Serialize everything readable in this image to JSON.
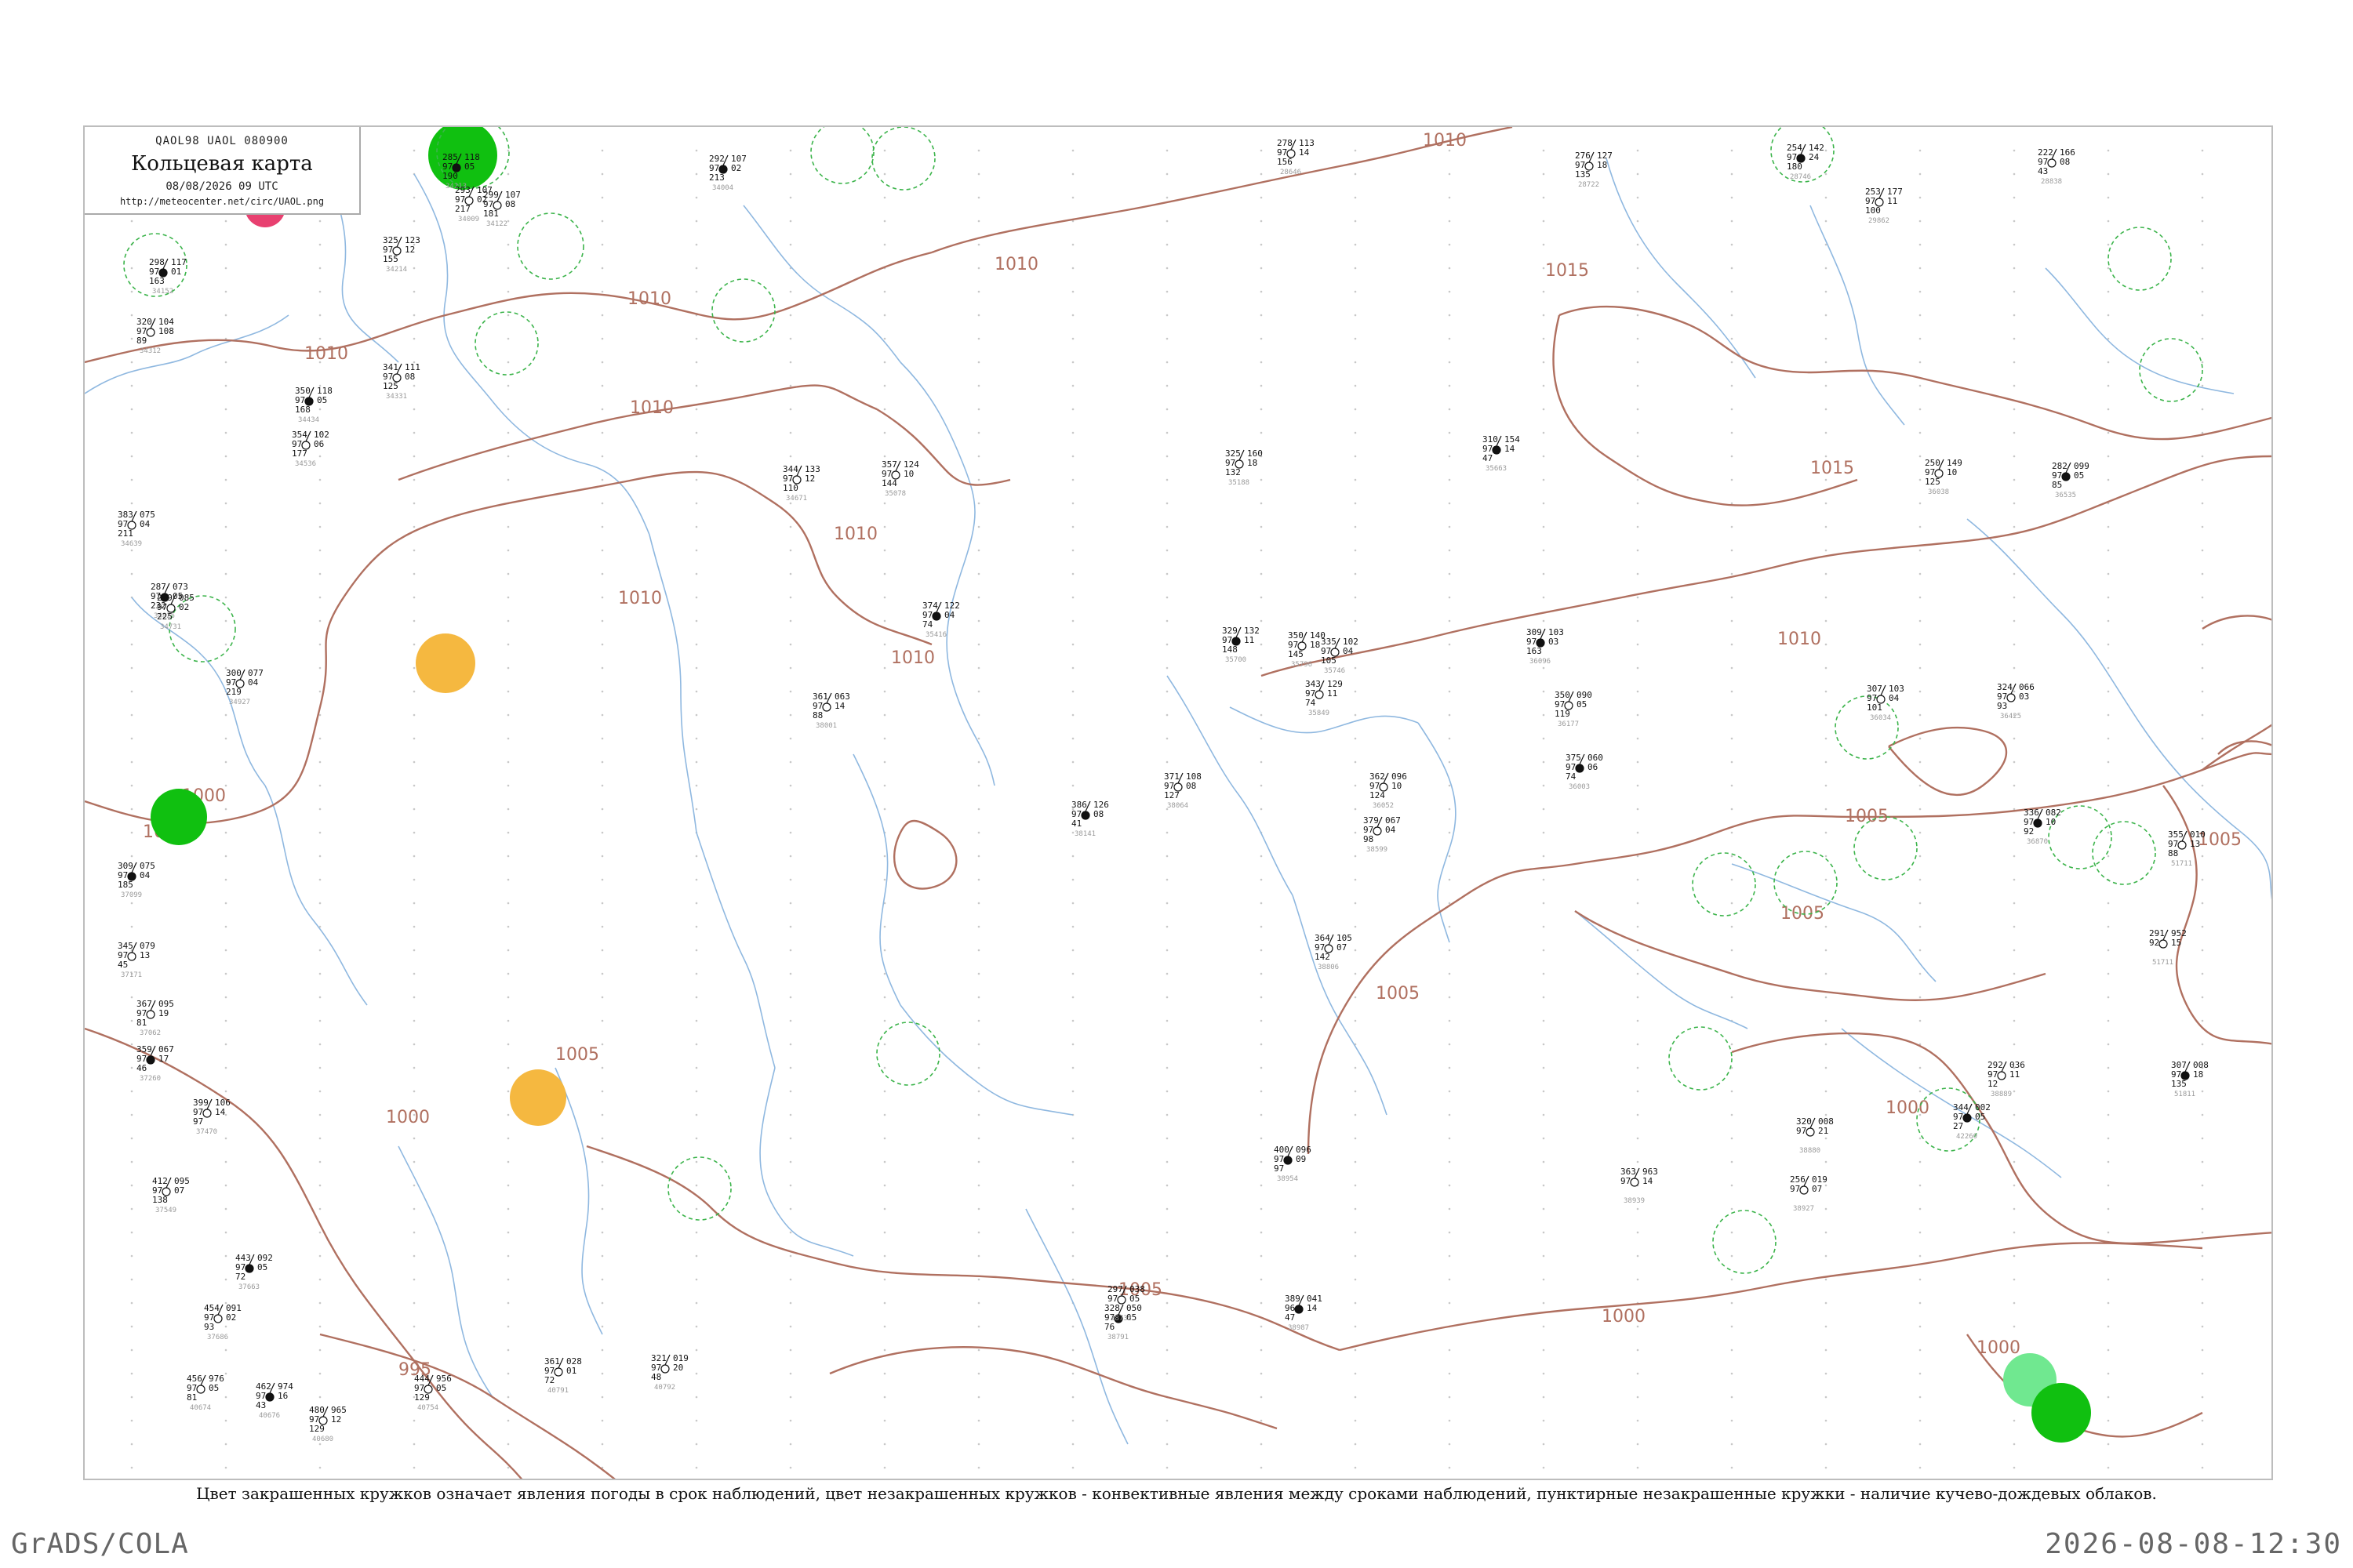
{
  "header": {
    "chart_code": "QAOL98  UAOL  080900",
    "title": "Кольцевая карта",
    "datetime": "08/08/2026 09 UTC",
    "url": "http://meteocenter.net/circ/UAOL.png"
  },
  "caption": "Цвет закрашенных кружков означает явления погоды в срок наблюдений, цвет незакрашенных кружков - конвективные явления между сроками наблюдений, пунктирные незакрашенные кружки - наличие кучево-дождевых облаков.",
  "footer": {
    "left": "GrADS/COLA",
    "right": "2026-08-08-12:30"
  },
  "colors": {
    "isobar": "#b07060",
    "river": "#8fb8e0",
    "green_weather": "#10c010",
    "light_green_weather": "#70e890",
    "orange_weather": "#f5b840",
    "red_weather": "#e84070",
    "cb_dashed": "#3cb44b"
  },
  "isobar_labels": [
    "1010",
    "1010",
    "1010",
    "1010",
    "1010",
    "1010",
    "1010",
    "1010",
    "1015",
    "1015",
    "1010",
    "1005",
    "1005",
    "1005",
    "1005",
    "1000",
    "1005",
    "1000",
    "1000",
    "995",
    "1005",
    "1005",
    "1000",
    "1000"
  ],
  "stations": [
    {
      "pressure": "298",
      "change": "117",
      "temp": "97",
      "dew": "01",
      "cloud": "163",
      "name": "34152"
    },
    {
      "pressure": "320",
      "change": "104",
      "temp": "97",
      "dew": "108",
      "cloud": "89",
      "name": "34312"
    },
    {
      "pressure": "325",
      "change": "123",
      "temp": "97",
      "dew": "12",
      "cloud": "155",
      "name": "34214"
    },
    {
      "pressure": "285",
      "change": "118",
      "temp": "97",
      "dew": "05",
      "cloud": "190",
      "name": "34213"
    },
    {
      "pressure": "293",
      "change": "107",
      "temp": "97",
      "dew": "02",
      "cloud": "217",
      "name": "34009"
    },
    {
      "pressure": "299",
      "change": "107",
      "temp": "97",
      "dew": "08",
      "cloud": "181",
      "name": "34122"
    },
    {
      "pressure": "292",
      "change": "107",
      "temp": "97",
      "dew": "02",
      "cloud": "213",
      "name": "34004"
    },
    {
      "pressure": "278",
      "change": "113",
      "temp": "97",
      "dew": "14",
      "cloud": "156",
      "name": "28646"
    },
    {
      "pressure": "276",
      "change": "127",
      "temp": "97",
      "dew": "18",
      "cloud": "135",
      "name": "28722"
    },
    {
      "pressure": "254",
      "change": "142",
      "temp": "97",
      "dew": "24",
      "cloud": "180",
      "name": "28746"
    },
    {
      "pressure": "222",
      "change": "166",
      "temp": "97",
      "dew": "08",
      "cloud": "43",
      "name": "28838"
    },
    {
      "pressure": "341",
      "change": "111",
      "temp": "97",
      "dew": "08",
      "cloud": "125",
      "name": "34331"
    },
    {
      "pressure": "350",
      "change": "118",
      "temp": "97",
      "dew": "05",
      "cloud": "168",
      "name": "34434"
    },
    {
      "pressure": "354",
      "change": "102",
      "temp": "97",
      "dew": "06",
      "cloud": "177",
      "name": "34536"
    },
    {
      "pressure": "383",
      "change": "075",
      "temp": "97",
      "dew": "04",
      "cloud": "211",
      "name": "34639"
    },
    {
      "pressure": "287",
      "change": "073",
      "temp": "97",
      "dew": "05",
      "cloud": "232",
      "name": "34825"
    },
    {
      "pressure": "300",
      "change": "077",
      "temp": "97",
      "dew": "04",
      "cloud": "219",
      "name": "34927"
    },
    {
      "pressure": "279",
      "change": "085",
      "temp": "97",
      "dew": "02",
      "cloud": "225",
      "name": "34731"
    },
    {
      "pressure": "309",
      "change": "075",
      "temp": "97",
      "dew": "04",
      "cloud": "185",
      "name": "37099"
    },
    {
      "pressure": "345",
      "change": "079",
      "temp": "97",
      "dew": "13",
      "cloud": "45",
      "name": "37171"
    },
    {
      "pressure": "367",
      "change": "095",
      "temp": "97",
      "dew": "19",
      "cloud": "81",
      "name": "37062"
    },
    {
      "pressure": "359",
      "change": "067",
      "temp": "97",
      "dew": "17",
      "cloud": "46",
      "name": "37260"
    },
    {
      "pressure": "399",
      "change": "106",
      "temp": "97",
      "dew": "14",
      "cloud": "97",
      "name": "37470"
    },
    {
      "pressure": "412",
      "change": "095",
      "temp": "97",
      "dew": "07",
      "cloud": "138",
      "name": "37549"
    },
    {
      "pressure": "443",
      "change": "092",
      "temp": "97",
      "dew": "05",
      "cloud": "72",
      "name": "37663"
    },
    {
      "pressure": "454",
      "change": "091",
      "temp": "97",
      "dew": "02",
      "cloud": "93",
      "name": "37686"
    },
    {
      "pressure": "456",
      "change": "976",
      "temp": "97",
      "dew": "05",
      "cloud": "81",
      "name": "40674"
    },
    {
      "pressure": "462",
      "change": "974",
      "temp": "97",
      "dew": "16",
      "cloud": "43",
      "name": "40676"
    },
    {
      "pressure": "480",
      "change": "965",
      "temp": "97",
      "dew": "12",
      "cloud": "129",
      "name": "40680"
    },
    {
      "pressure": "444",
      "change": "956",
      "temp": "97",
      "dew": "05",
      "cloud": "129",
      "name": "40754"
    },
    {
      "pressure": "400",
      "change": "096",
      "temp": "97",
      "dew": "09",
      "cloud": "97",
      "name": "38954"
    },
    {
      "pressure": "364",
      "change": "105",
      "temp": "97",
      "dew": "07",
      "cloud": "142",
      "name": "38806"
    },
    {
      "pressure": "379",
      "change": "067",
      "temp": "97",
      "dew": "04",
      "cloud": "98",
      "name": "38599"
    },
    {
      "pressure": "386",
      "change": "126",
      "temp": "97",
      "dew": "08",
      "cloud": "41",
      "name": "38141"
    },
    {
      "pressure": "371",
      "change": "108",
      "temp": "97",
      "dew": "08",
      "cloud": "127",
      "name": "38064"
    },
    {
      "pressure": "361",
      "change": "063",
      "temp": "97",
      "dew": "14",
      "cloud": "88",
      "name": "38001"
    },
    {
      "pressure": "374",
      "change": "122",
      "temp": "97",
      "dew": "04",
      "cloud": "74",
      "name": "35416"
    },
    {
      "pressure": "357",
      "change": "124",
      "temp": "97",
      "dew": "10",
      "cloud": "144",
      "name": "35078"
    },
    {
      "pressure": "344",
      "change": "133",
      "temp": "97",
      "dew": "12",
      "cloud": "110",
      "name": "34671"
    },
    {
      "pressure": "310",
      "change": "154",
      "temp": "97",
      "dew": "14",
      "cloud": "47",
      "name": "35663"
    },
    {
      "pressure": "350",
      "change": "140",
      "temp": "97",
      "dew": "18",
      "cloud": "145",
      "name": "35796"
    },
    {
      "pressure": "325",
      "change": "160",
      "temp": "97",
      "dew": "18",
      "cloud": "132",
      "name": "35188"
    },
    {
      "pressure": "329",
      "change": "132",
      "temp": "97",
      "dew": "11",
      "cloud": "148",
      "name": "35700"
    },
    {
      "pressure": "343",
      "change": "129",
      "temp": "97",
      "dew": "11",
      "cloud": "74",
      "name": "35849"
    },
    {
      "pressure": "362",
      "change": "096",
      "temp": "97",
      "dew": "10",
      "cloud": "124",
      "name": "36052"
    },
    {
      "pressure": "375",
      "change": "060",
      "temp": "97",
      "dew": "06",
      "cloud": "74",
      "name": "36003"
    },
    {
      "pressure": "350",
      "change": "090",
      "temp": "97",
      "dew": "05",
      "cloud": "119",
      "name": "36177"
    },
    {
      "pressure": "335",
      "change": "102",
      "temp": "97",
      "dew": "04",
      "cloud": "105",
      "name": "35746"
    },
    {
      "pressure": "309",
      "change": "103",
      "temp": "97",
      "dew": "03",
      "cloud": "163",
      "name": "36096"
    },
    {
      "pressure": "307",
      "change": "103",
      "temp": "97",
      "dew": "04",
      "cloud": "101",
      "name": "36034"
    },
    {
      "pressure": "324",
      "change": "066",
      "temp": "97",
      "dew": "03",
      "cloud": "93",
      "name": "36425"
    },
    {
      "pressure": "282",
      "change": "099",
      "temp": "97",
      "dew": "05",
      "cloud": "85",
      "name": "36535"
    },
    {
      "pressure": "250",
      "change": "149",
      "temp": "97",
      "dew": "10",
      "cloud": "125",
      "name": "36038"
    },
    {
      "pressure": "253",
      "change": "177",
      "temp": "97",
      "dew": "11",
      "cloud": "100",
      "name": "29862"
    },
    {
      "pressure": "336",
      "change": "082",
      "temp": "97",
      "dew": "10",
      "cloud": "92",
      "name": "36870"
    },
    {
      "pressure": "355",
      "change": "010",
      "temp": "97",
      "dew": "13",
      "cloud": "88",
      "name": "51711"
    },
    {
      "pressure": "291",
      "change": "952",
      "temp": "92",
      "dew": "15",
      "cloud": "",
      "name": "51711"
    },
    {
      "pressure": "307",
      "change": "008",
      "temp": "97",
      "dew": "18",
      "cloud": "135",
      "name": "51811"
    },
    {
      "pressure": "292",
      "change": "036",
      "temp": "97",
      "dew": "11",
      "cloud": "12",
      "name": "38889"
    },
    {
      "pressure": "320",
      "change": "008",
      "temp": "97",
      "dew": "21",
      "cloud": "",
      "name": "38880"
    },
    {
      "pressure": "344",
      "change": "002",
      "temp": "97",
      "dew": "05",
      "cloud": "27",
      "name": "42260"
    },
    {
      "pressure": "256",
      "change": "019",
      "temp": "97",
      "dew": "07",
      "cloud": "",
      "name": "38927"
    },
    {
      "pressure": "363",
      "change": "963",
      "temp": "97",
      "dew": "14",
      "cloud": "",
      "name": "38939"
    },
    {
      "pressure": "389",
      "change": "041",
      "temp": "96",
      "dew": "14",
      "cloud": "47",
      "name": "38987"
    },
    {
      "pressure": "361",
      "change": "028",
      "temp": "97",
      "dew": "01",
      "cloud": "72",
      "name": "40791"
    },
    {
      "pressure": "321",
      "change": "019",
      "temp": "97",
      "dew": "20",
      "cloud": "48",
      "name": "40792"
    },
    {
      "pressure": "328",
      "change": "050",
      "temp": "97",
      "dew": "05",
      "cloud": "76",
      "name": "38791"
    },
    {
      "pressure": "297",
      "change": "038",
      "temp": "97",
      "dew": "05",
      "cloud": "",
      "name": "38732"
    }
  ],
  "weather_markers": [
    {
      "type": "green",
      "label": "green-weather-circle"
    },
    {
      "type": "red",
      "label": "red-weather-circle"
    },
    {
      "type": "orange",
      "label": "orange-weather-circle"
    },
    {
      "type": "light-green",
      "label": "light-green-weather-circle"
    }
  ]
}
